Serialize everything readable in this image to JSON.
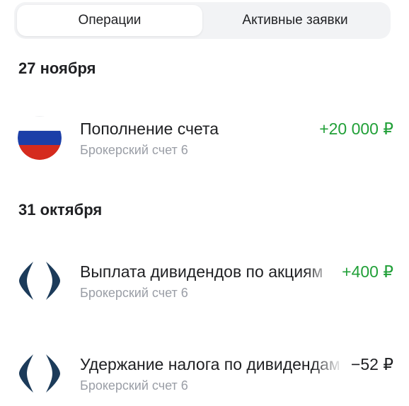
{
  "tabs": [
    {
      "label": "Операции",
      "active": true
    },
    {
      "label": "Активные заявки",
      "active": false
    }
  ],
  "sections": [
    {
      "date": "27 ноября",
      "operations": [
        {
          "icon": "russia-flag-icon",
          "title": "Пополнение счета",
          "subtitle": "Брокерский счет 6",
          "amount": "+20 000 ₽",
          "amount_type": "positive"
        }
      ]
    },
    {
      "date": "31 октября",
      "operations": [
        {
          "icon": "company-logo-icon",
          "title": "Выплата дивидендов по акциям",
          "subtitle": "Брокерский счет 6",
          "amount": "+400 ₽",
          "amount_type": "positive"
        },
        {
          "icon": "company-logo-icon",
          "title": "Удержание налога по дивидендам",
          "subtitle": "Брокерский счет 6",
          "amount": "−52 ₽",
          "amount_type": "negative"
        }
      ]
    }
  ],
  "colors": {
    "positive": "#21a038",
    "text": "#1f2023",
    "secondary": "#9a9ea6",
    "logo": "#1c3b5a",
    "flag_white": "#ffffff",
    "flag_blue": "#1c3fa8",
    "flag_red": "#d52b1e"
  }
}
